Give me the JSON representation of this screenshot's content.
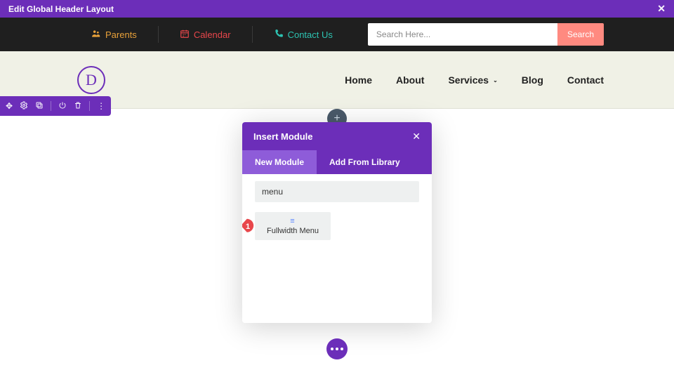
{
  "admin": {
    "title": "Edit Global Header Layout"
  },
  "util": {
    "parents": "Parents",
    "calendar": "Calendar",
    "contact": "Contact Us",
    "search_placeholder": "Search Here...",
    "search_btn": "Search"
  },
  "nav": {
    "items": [
      "Home",
      "About",
      "Services",
      "Blog",
      "Contact"
    ]
  },
  "builder_tools": [
    "move",
    "settings",
    "duplicate",
    "power",
    "delete",
    "more"
  ],
  "modal": {
    "title": "Insert Module",
    "tabs": {
      "new": "New Module",
      "library": "Add From Library"
    },
    "filter_value": "menu",
    "module_label": "Fullwidth Menu",
    "callout_num": "1"
  }
}
